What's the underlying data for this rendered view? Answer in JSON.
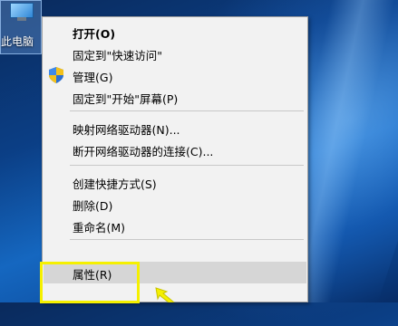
{
  "desktop": {
    "icon_label": "此电脑"
  },
  "context_menu": {
    "items": [
      {
        "label": "打开(O)"
      },
      {
        "label": "固定到\"快速访问\""
      },
      {
        "label": "管理(G)"
      },
      {
        "label": "固定到\"开始\"屏幕(P)"
      },
      {
        "label": "映射网络驱动器(N)..."
      },
      {
        "label": "断开网络驱动器的连接(C)..."
      },
      {
        "label": "创建快捷方式(S)"
      },
      {
        "label": "删除(D)"
      },
      {
        "label": "重命名(M)"
      },
      {
        "label": "属性(R)"
      }
    ],
    "highlighted_item": "属性(R)",
    "icons": {
      "manage": "uac-shield-icon"
    }
  },
  "annotation": {
    "highlight_color": "#f5f000"
  }
}
